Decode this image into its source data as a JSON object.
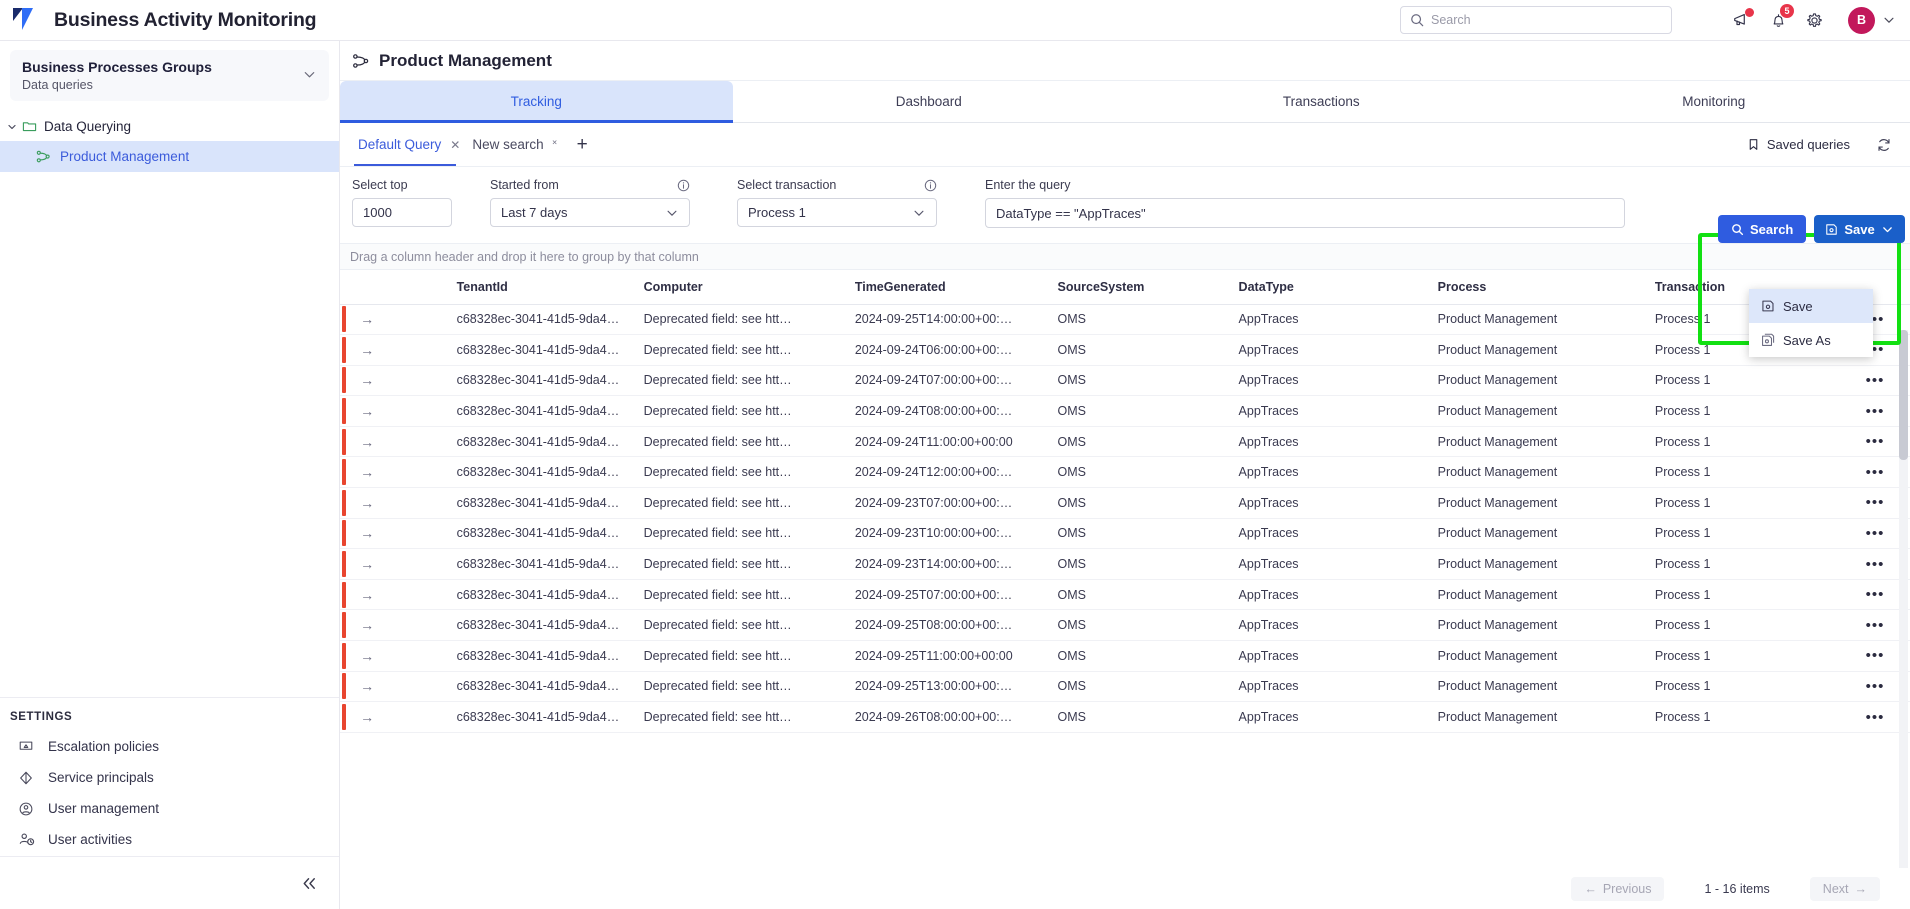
{
  "app": {
    "title": "Business Activity Monitoring",
    "logo_icon": "brand-logo-icon"
  },
  "topbar": {
    "search_placeholder": "Search",
    "search_value": "",
    "search_icon": "search-icon",
    "announcements_icon": "megaphone-icon",
    "notifications_icon": "bell-icon",
    "notifications_count": "5",
    "settings_icon": "gear-icon",
    "avatar_initial": "B",
    "avatar_chevron_icon": "chevron-down-icon"
  },
  "sidebar": {
    "group": {
      "title": "Business Processes Groups",
      "subtitle": "Data queries",
      "chevron_icon": "chevron-down-icon"
    },
    "tree": {
      "folder_label": "Data Querying",
      "folder_icon": "folder-icon",
      "folder_chevron_icon": "chevron-down-icon",
      "leaf_label": "Product Management",
      "leaf_icon": "process-flow-icon"
    },
    "settings_header": "SETTINGS",
    "settings_items": [
      {
        "label": "Escalation policies",
        "icon": "escalation-icon"
      },
      {
        "label": "Service principals",
        "icon": "service-principal-icon"
      },
      {
        "label": "User management",
        "icon": "user-circle-icon"
      },
      {
        "label": "User activities",
        "icon": "user-clock-icon"
      }
    ],
    "collapse_icon": "double-chevron-left-icon"
  },
  "main": {
    "page_title": "Product Management",
    "page_title_icon": "process-flow-icon",
    "tabs": [
      {
        "label": "Tracking",
        "active": true
      },
      {
        "label": "Dashboard",
        "active": false
      },
      {
        "label": "Transactions",
        "active": false
      },
      {
        "label": "Monitoring",
        "active": false
      }
    ],
    "query_tabs": [
      {
        "label": "Default Query",
        "active": true,
        "close_icon": "close-icon"
      },
      {
        "label": "New search",
        "active": false,
        "close_icon": "close-icon"
      }
    ],
    "add_tab_label": "+",
    "saved_queries_label": "Saved queries",
    "saved_queries_icon": "bookmark-icon",
    "refresh_icon": "refresh-icon"
  },
  "query_form": {
    "select_top": {
      "label": "Select top",
      "value": "1000"
    },
    "started_from": {
      "label": "Started from",
      "value": "Last 7 days",
      "info_icon": "info-icon",
      "chevron_icon": "chevron-down-icon"
    },
    "select_transaction": {
      "label": "Select transaction",
      "value": "Process 1",
      "info_icon": "info-icon",
      "chevron_icon": "chevron-down-icon"
    },
    "enter_query": {
      "label": "Enter the query",
      "value": "DataType == \"AppTraces\""
    },
    "search_button": {
      "label": "Search",
      "icon": "search-icon"
    },
    "save_button": {
      "label": "Save",
      "icon": "save-disk-icon",
      "chevron_icon": "chevron-down-icon"
    },
    "save_menu": [
      {
        "label": "Save",
        "icon": "save-disk-icon",
        "highlighted": true
      },
      {
        "label": "Save As",
        "icon": "save-as-disk-icon",
        "highlighted": false
      }
    ],
    "highlight_color": "#12e012"
  },
  "grid": {
    "group_hint": "Drag a column header and drop it here to group by that column",
    "columns": [
      "TenantId",
      "Computer",
      "TimeGenerated",
      "SourceSystem",
      "DataType",
      "Process",
      "Transaction"
    ],
    "row_action_icon": "arrow-right-icon",
    "row_menu_icon": "ellipsis-icon",
    "status_color": "#e8452f",
    "rows": [
      {
        "TenantId": "c68328ec-3041-41d5-9da4…",
        "Computer": "Deprecated field: see htt…",
        "TimeGenerated": "2024-09-25T14:00:00+00:…",
        "SourceSystem": "OMS",
        "DataType": "AppTraces",
        "Process": "Product Management",
        "Transaction": "Process 1"
      },
      {
        "TenantId": "c68328ec-3041-41d5-9da4…",
        "Computer": "Deprecated field: see htt…",
        "TimeGenerated": "2024-09-24T06:00:00+00:…",
        "SourceSystem": "OMS",
        "DataType": "AppTraces",
        "Process": "Product Management",
        "Transaction": "Process 1"
      },
      {
        "TenantId": "c68328ec-3041-41d5-9da4…",
        "Computer": "Deprecated field: see htt…",
        "TimeGenerated": "2024-09-24T07:00:00+00:…",
        "SourceSystem": "OMS",
        "DataType": "AppTraces",
        "Process": "Product Management",
        "Transaction": "Process 1"
      },
      {
        "TenantId": "c68328ec-3041-41d5-9da4…",
        "Computer": "Deprecated field: see htt…",
        "TimeGenerated": "2024-09-24T08:00:00+00:…",
        "SourceSystem": "OMS",
        "DataType": "AppTraces",
        "Process": "Product Management",
        "Transaction": "Process 1"
      },
      {
        "TenantId": "c68328ec-3041-41d5-9da4…",
        "Computer": "Deprecated field: see htt…",
        "TimeGenerated": "2024-09-24T11:00:00+00:00",
        "SourceSystem": "OMS",
        "DataType": "AppTraces",
        "Process": "Product Management",
        "Transaction": "Process 1"
      },
      {
        "TenantId": "c68328ec-3041-41d5-9da4…",
        "Computer": "Deprecated field: see htt…",
        "TimeGenerated": "2024-09-24T12:00:00+00:…",
        "SourceSystem": "OMS",
        "DataType": "AppTraces",
        "Process": "Product Management",
        "Transaction": "Process 1"
      },
      {
        "TenantId": "c68328ec-3041-41d5-9da4…",
        "Computer": "Deprecated field: see htt…",
        "TimeGenerated": "2024-09-23T07:00:00+00:…",
        "SourceSystem": "OMS",
        "DataType": "AppTraces",
        "Process": "Product Management",
        "Transaction": "Process 1"
      },
      {
        "TenantId": "c68328ec-3041-41d5-9da4…",
        "Computer": "Deprecated field: see htt…",
        "TimeGenerated": "2024-09-23T10:00:00+00:…",
        "SourceSystem": "OMS",
        "DataType": "AppTraces",
        "Process": "Product Management",
        "Transaction": "Process 1"
      },
      {
        "TenantId": "c68328ec-3041-41d5-9da4…",
        "Computer": "Deprecated field: see htt…",
        "TimeGenerated": "2024-09-23T14:00:00+00:…",
        "SourceSystem": "OMS",
        "DataType": "AppTraces",
        "Process": "Product Management",
        "Transaction": "Process 1"
      },
      {
        "TenantId": "c68328ec-3041-41d5-9da4…",
        "Computer": "Deprecated field: see htt…",
        "TimeGenerated": "2024-09-25T07:00:00+00:…",
        "SourceSystem": "OMS",
        "DataType": "AppTraces",
        "Process": "Product Management",
        "Transaction": "Process 1"
      },
      {
        "TenantId": "c68328ec-3041-41d5-9da4…",
        "Computer": "Deprecated field: see htt…",
        "TimeGenerated": "2024-09-25T08:00:00+00:…",
        "SourceSystem": "OMS",
        "DataType": "AppTraces",
        "Process": "Product Management",
        "Transaction": "Process 1"
      },
      {
        "TenantId": "c68328ec-3041-41d5-9da4…",
        "Computer": "Deprecated field: see htt…",
        "TimeGenerated": "2024-09-25T11:00:00+00:00",
        "SourceSystem": "OMS",
        "DataType": "AppTraces",
        "Process": "Product Management",
        "Transaction": "Process 1"
      },
      {
        "TenantId": "c68328ec-3041-41d5-9da4…",
        "Computer": "Deprecated field: see htt…",
        "TimeGenerated": "2024-09-25T13:00:00+00:…",
        "SourceSystem": "OMS",
        "DataType": "AppTraces",
        "Process": "Product Management",
        "Transaction": "Process 1"
      },
      {
        "TenantId": "c68328ec-3041-41d5-9da4…",
        "Computer": "Deprecated field: see htt…",
        "TimeGenerated": "2024-09-26T08:00:00+00:…",
        "SourceSystem": "OMS",
        "DataType": "AppTraces",
        "Process": "Product Management",
        "Transaction": "Process 1"
      }
    ]
  },
  "pagination": {
    "previous_label": "Previous",
    "previous_icon": "arrow-left-icon",
    "info": "1 - 16 items",
    "next_label": "Next",
    "next_icon": "arrow-right-icon"
  }
}
